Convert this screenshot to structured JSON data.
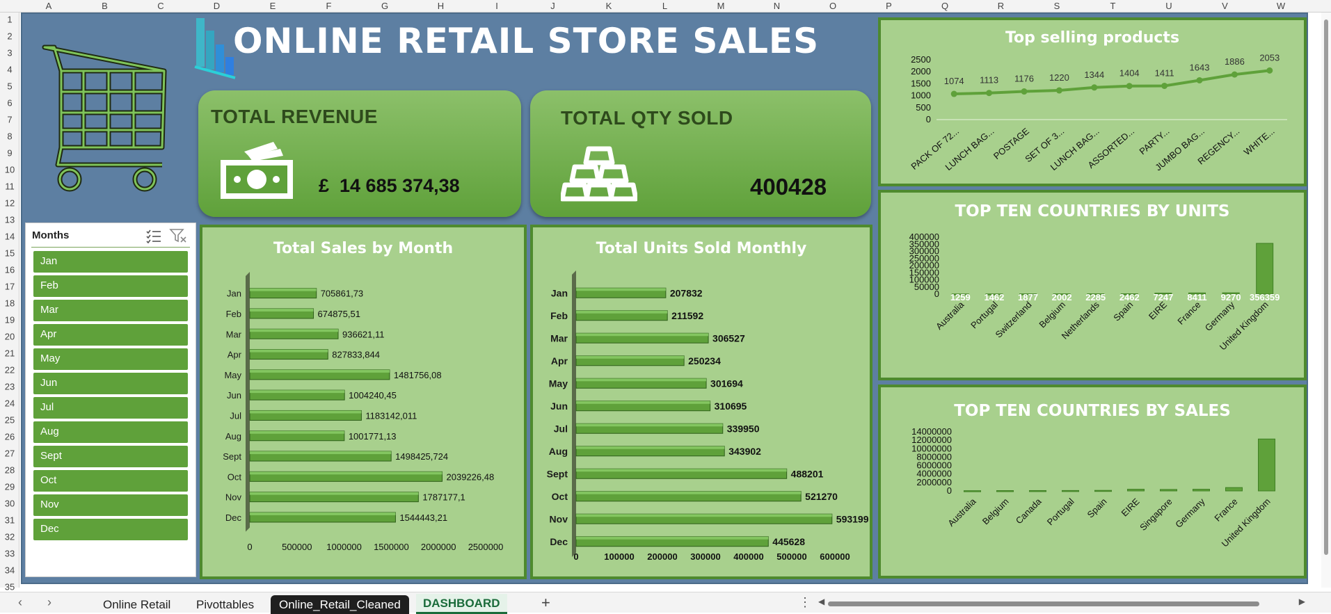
{
  "grid": {
    "columns": [
      "A",
      "B",
      "C",
      "D",
      "E",
      "F",
      "G",
      "H",
      "I",
      "J",
      "K",
      "L",
      "M",
      "N",
      "O",
      "P",
      "Q",
      "R",
      "S",
      "T",
      "U",
      "V",
      "W"
    ],
    "rows": [
      "1",
      "2",
      "3",
      "4",
      "5",
      "6",
      "7",
      "8",
      "9",
      "10",
      "11",
      "12",
      "13",
      "14",
      "15",
      "16",
      "17",
      "18",
      "19",
      "20",
      "21",
      "22",
      "23",
      "24",
      "25",
      "26",
      "27",
      "28",
      "29",
      "30",
      "31",
      "32",
      "33",
      "34",
      "35"
    ]
  },
  "dashboard": {
    "title": "ONLINE RETAIL STORE SALES",
    "revenue": {
      "label": "TOTAL REVENUE",
      "value": "£  14 685 374,38"
    },
    "qty": {
      "label": "TOTAL QTY SOLD",
      "value": "400428"
    }
  },
  "slicer": {
    "header": "Months",
    "items": [
      "Jan",
      "Feb",
      "Mar",
      "Apr",
      "May",
      "Jun",
      "Jul",
      "Aug",
      "Sept",
      "Oct",
      "Nov",
      "Dec"
    ]
  },
  "chart_data": [
    {
      "id": "sales_month",
      "type": "bar",
      "title": "Total Sales by Month",
      "orientation": "horizontal",
      "categories": [
        "Jan",
        "Feb",
        "Mar",
        "Apr",
        "May",
        "Jun",
        "Jul",
        "Aug",
        "Sept",
        "Oct",
        "Nov",
        "Dec"
      ],
      "values": [
        705861.73,
        674875.51,
        936621.11,
        827833.844,
        1481756.08,
        1004240.45,
        1183142.011,
        1001771.13,
        1498425.724,
        2039226.48,
        1787177.1,
        1544443.21
      ],
      "labels": [
        "705861,73",
        "674875,51",
        "936621,11",
        "827833,844",
        "1481756,08",
        "1004240,45",
        "1183142,011",
        "1001771,13",
        "1498425,724",
        "2039226,48",
        "1787177,1",
        "1544443,21"
      ],
      "xlim": [
        0,
        2500000
      ],
      "ticks": [
        "0",
        "500000",
        "1000000",
        "1500000",
        "2000000",
        "2500000"
      ]
    },
    {
      "id": "units_month",
      "type": "bar",
      "title": "Total Units Sold Monthly",
      "orientation": "horizontal",
      "categories": [
        "Jan",
        "Feb",
        "Mar",
        "Apr",
        "May",
        "Jun",
        "Jul",
        "Aug",
        "Sept",
        "Oct",
        "Nov",
        "Dec"
      ],
      "values": [
        207832,
        211592,
        306527,
        250234,
        301694,
        310695,
        339950,
        343902,
        488201,
        521270,
        593199,
        445628
      ],
      "labels": [
        "207832",
        "211592",
        "306527",
        "250234",
        "301694",
        "310695",
        "339950",
        "343902",
        "488201",
        "521270",
        "593199",
        "445628"
      ],
      "xlim": [
        0,
        600000
      ],
      "ticks": [
        "0",
        "100000",
        "200000",
        "300000",
        "400000",
        "500000",
        "600000"
      ]
    },
    {
      "id": "top_products",
      "type": "line",
      "title": "Top selling products",
      "categories": [
        "PACK OF 72...",
        "LUNCH BAG...",
        "POSTAGE",
        "SET OF 3...",
        "LUNCH BAG...",
        "ASSORTED...",
        "PARTY...",
        "JUMBO BAG...",
        "REGENCY...",
        "WHITE..."
      ],
      "values": [
        1074,
        1113,
        1176,
        1220,
        1344,
        1404,
        1411,
        1643,
        1886,
        2053
      ],
      "labels": [
        "1074",
        "1113",
        "1176",
        "1220",
        "1344",
        "1404",
        "1411",
        "1643",
        "1886",
        "2053"
      ],
      "ylim": [
        0,
        2500
      ],
      "ticks": [
        "0",
        "500",
        "1000",
        "1500",
        "2000",
        "2500"
      ]
    },
    {
      "id": "countries_units",
      "type": "bar",
      "title": "TOP TEN COUNTRIES BY UNITS",
      "categories": [
        "Australia",
        "Portugal",
        "Switzerland",
        "Belgium",
        "Netherlands",
        "Spain",
        "EIRE",
        "France",
        "Germany",
        "United Kingdom"
      ],
      "values": [
        1259,
        1462,
        1877,
        2002,
        2285,
        2462,
        7247,
        8411,
        9270,
        356359
      ],
      "labels": [
        "1259",
        "1462",
        "1877",
        "2002",
        "2285",
        "2462",
        "7247",
        "8411",
        "9270",
        "356359"
      ],
      "ylim": [
        0,
        400000
      ],
      "ticks": [
        "0",
        "50000",
        "100000",
        "150000",
        "200000",
        "250000",
        "300000",
        "350000",
        "400000"
      ]
    },
    {
      "id": "countries_sales",
      "type": "bar",
      "title": "TOP TEN COUNTRIES BY SALES",
      "categories": [
        "Australia",
        "Belgium",
        "Canada",
        "Portugal",
        "Spain",
        "EIRE",
        "Singapore",
        "Germany",
        "France",
        "United Kingdom"
      ],
      "values": [
        60000,
        80000,
        90000,
        100000,
        130000,
        400000,
        350000,
        400000,
        800000,
        12300000
      ],
      "ylim": [
        0,
        14000000
      ],
      "ticks": [
        "0",
        "2000000",
        "4000000",
        "6000000",
        "8000000",
        "10000000",
        "12000000",
        "14000000"
      ]
    }
  ],
  "sheet_tabs": {
    "tabs": [
      "Online Retail",
      "Pivottables",
      "Online_Retail_Cleaned",
      "DASHBOARD"
    ],
    "add": "+"
  },
  "colors": {
    "panel": "#a8d08d",
    "border": "#4e8a2e",
    "bar": "#5fa13a",
    "background": "#5d7fa2"
  }
}
